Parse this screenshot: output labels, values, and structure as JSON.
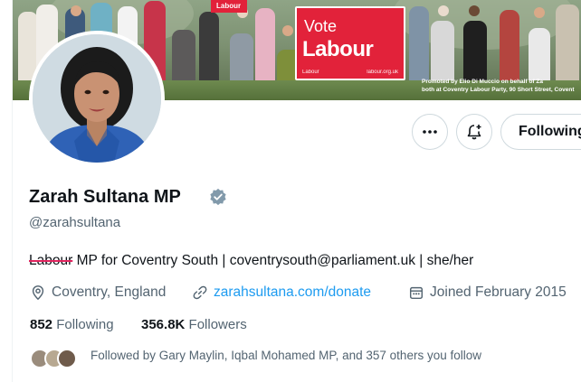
{
  "banner": {
    "sign_vote": "Vote",
    "sign_party": "Labour",
    "sign_left": "Labour",
    "sign_right": "labour.org.uk",
    "flag_text": "Labour",
    "promo_line1": "Promoted by Elio Di Muccio on behalf of Za",
    "promo_line2": "both at Coventry Labour Party, 90 Short Street, Covent"
  },
  "actions": {
    "more_icon": "more-dots-icon",
    "notify_icon": "bell-plus-icon",
    "following_label": "Following"
  },
  "profile": {
    "name": "Zarah Sultana MP",
    "handle": "@zarahsultana",
    "bio_struck": "Labour",
    "bio_rest": " MP for Coventry South | coventrysouth@parliament.uk | she/her",
    "location": "Coventry, England",
    "website": "zarahsultana.com/donate",
    "joined": "Joined February 2015",
    "verified_color": "#829aab"
  },
  "stats": {
    "following_count": "852",
    "following_label": "Following",
    "followers_count": "356.8K",
    "followers_label": "Followers"
  },
  "followed_by": "Followed by Gary Maylin, Iqbal Mohamed MP, and 357 others you follow",
  "colors": {
    "accent_link": "#1d9bf0",
    "secondary_text": "#536471",
    "sign_red": "#e2223a",
    "border": "#cfd9de"
  }
}
